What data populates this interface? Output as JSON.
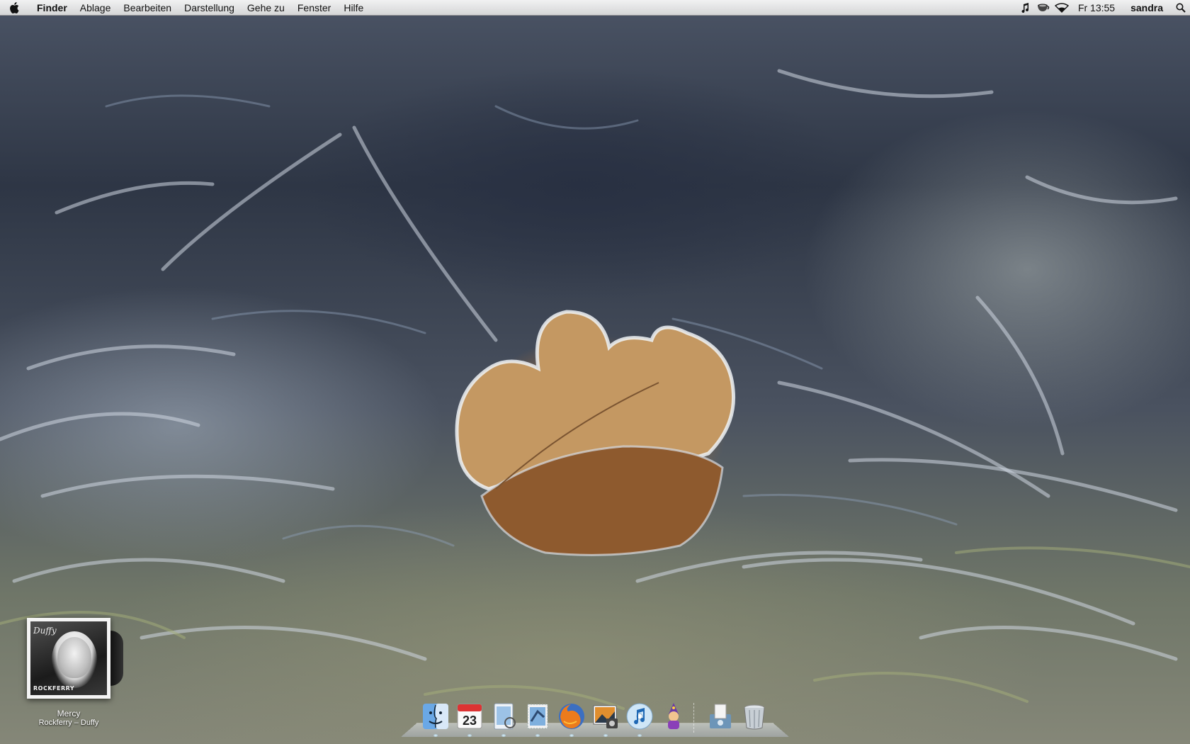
{
  "menubar": {
    "apple_icon": "apple-icon",
    "app_name": "Finder",
    "menus": [
      "Ablage",
      "Bearbeiten",
      "Darstellung",
      "Gehe zu",
      "Fenster",
      "Hilfe"
    ],
    "status_icons": [
      "music-note-icon",
      "coffee-cup-icon",
      "wifi-icon"
    ],
    "clock": "Fr 13:55",
    "user": "sandra",
    "search_icon": "spotlight-search-icon"
  },
  "desktop": {
    "wallpaper": "frosted-leaf-on-grass"
  },
  "now_playing": {
    "album_cover_text": "Duffy",
    "album_cover_band": "ROCKFERRY",
    "track": "Mercy",
    "meta": "Rockferry – Duffy"
  },
  "dock": {
    "items": [
      {
        "name": "finder",
        "icon": "finder-icon",
        "running": true
      },
      {
        "name": "ical",
        "icon": "calendar-icon",
        "date": "23",
        "running": true
      },
      {
        "name": "preview",
        "icon": "preview-icon",
        "running": true
      },
      {
        "name": "mail",
        "icon": "mail-stamp-icon",
        "running": true
      },
      {
        "name": "firefox",
        "icon": "firefox-icon",
        "running": true
      },
      {
        "name": "iphoto",
        "icon": "iphoto-icon",
        "running": true
      },
      {
        "name": "itunes",
        "icon": "itunes-icon",
        "running": true
      },
      {
        "name": "character",
        "icon": "wizard-character-icon",
        "running": false
      },
      {
        "name": "downloads-stack",
        "icon": "downloads-stack-icon",
        "running": false
      },
      {
        "name": "trash",
        "icon": "trash-icon",
        "running": false
      }
    ]
  },
  "colors": {
    "menubar_bg": "#e8e8e8",
    "leaf": "#c4965f",
    "frost": "#c9d1dc"
  }
}
